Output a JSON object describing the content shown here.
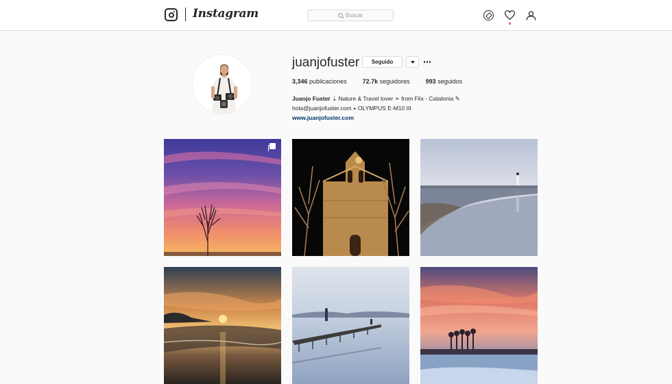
{
  "header": {
    "app_name": "Instagram",
    "search_placeholder": "Buscar",
    "icons": [
      "instagram-logo-icon",
      "search-icon",
      "compass-icon",
      "heart-icon",
      "profile-icon"
    ],
    "notification_dot_color": "#ed4956"
  },
  "profile": {
    "username": "juanjofuster",
    "follow_button_label": "Seguido",
    "stats": [
      {
        "count": "3,346",
        "label": "publicaciones"
      },
      {
        "count": "72.7k",
        "label": "seguidores"
      },
      {
        "count": "993",
        "label": "seguidos"
      }
    ],
    "bio": {
      "name": "Juanjo Fuster",
      "line1": " ⇣ Nature & Travel lover ➣ from Flix - Catalonia ✎",
      "line2": "hola@juanjofuster.com ⭑ OLYMPUS E-M10 III",
      "website": "www.juanjofuster.com"
    },
    "link_color": "#003569"
  },
  "posts": [
    {
      "subject": "purple sunset with bare tree",
      "multiple": true
    },
    {
      "subject": "lit stone church at night"
    },
    {
      "subject": "woman on wet beach"
    },
    {
      "subject": "sunset over waves"
    },
    {
      "subject": "man on pier over calm water"
    },
    {
      "subject": "palm trees under pink sky"
    }
  ]
}
